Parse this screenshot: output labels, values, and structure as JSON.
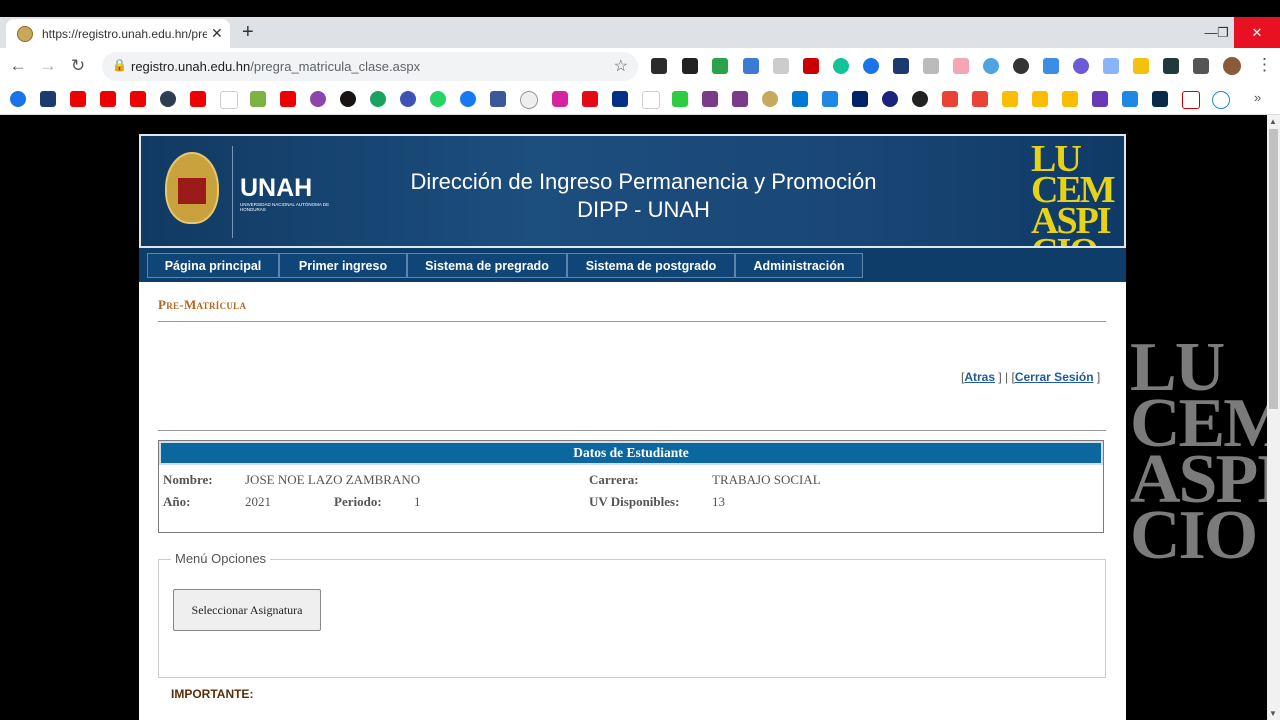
{
  "browser": {
    "tab_title": "https://registro.unah.edu.hn/pregra",
    "tab_close": "✕",
    "new_tab": "+",
    "window_controls": {
      "minimize": "—",
      "restore": "❐",
      "close": "✕"
    },
    "nav": {
      "back": "←",
      "forward": "→",
      "reload": "↻"
    },
    "url_domain": "registro.unah.edu.hn",
    "url_path": "/pregra_matricula_clase.aspx",
    "menu_icon": "⋮",
    "bookmarks_more": "»",
    "accent": "#1a73e8"
  },
  "banner": {
    "logo_text": "UNAH",
    "logo_subtext": "UNIVERSIDAD NACIONAL AUTÓNOMA DE HONDURAS",
    "title_line1": "Dirección de Ingreso Permanencia y Promoción",
    "title_line2": "DIPP - UNAH",
    "motto": "LUCEM ASPICIO",
    "brand_color": "#0d3d68"
  },
  "navbar": {
    "items": [
      {
        "label": "Página principal"
      },
      {
        "label": "Primer ingreso"
      },
      {
        "label": "Sistema de pregrado"
      },
      {
        "label": "Sistema de postgrado"
      },
      {
        "label": "Administración"
      }
    ]
  },
  "section_title": "Pre-Matrícula",
  "links": {
    "back": "Atras",
    "logout": "Cerrar Sesión"
  },
  "student": {
    "header": "Datos de Estudiante",
    "name_label": "Nombre:",
    "name_value": "JOSE NOE LAZO ZAMBRANO",
    "career_label": "Carrera:",
    "career_value": "TRABAJO SOCIAL",
    "year_label": "Año:",
    "year_value": "2021",
    "period_label": "Periodo:",
    "period_value": "1",
    "uv_label": "UV Disponibles:",
    "uv_value": "13"
  },
  "menu": {
    "legend": "Menú Opciones",
    "select_button": "Seleccionar Asignatura"
  },
  "important_label": "IMPORTANTE:"
}
